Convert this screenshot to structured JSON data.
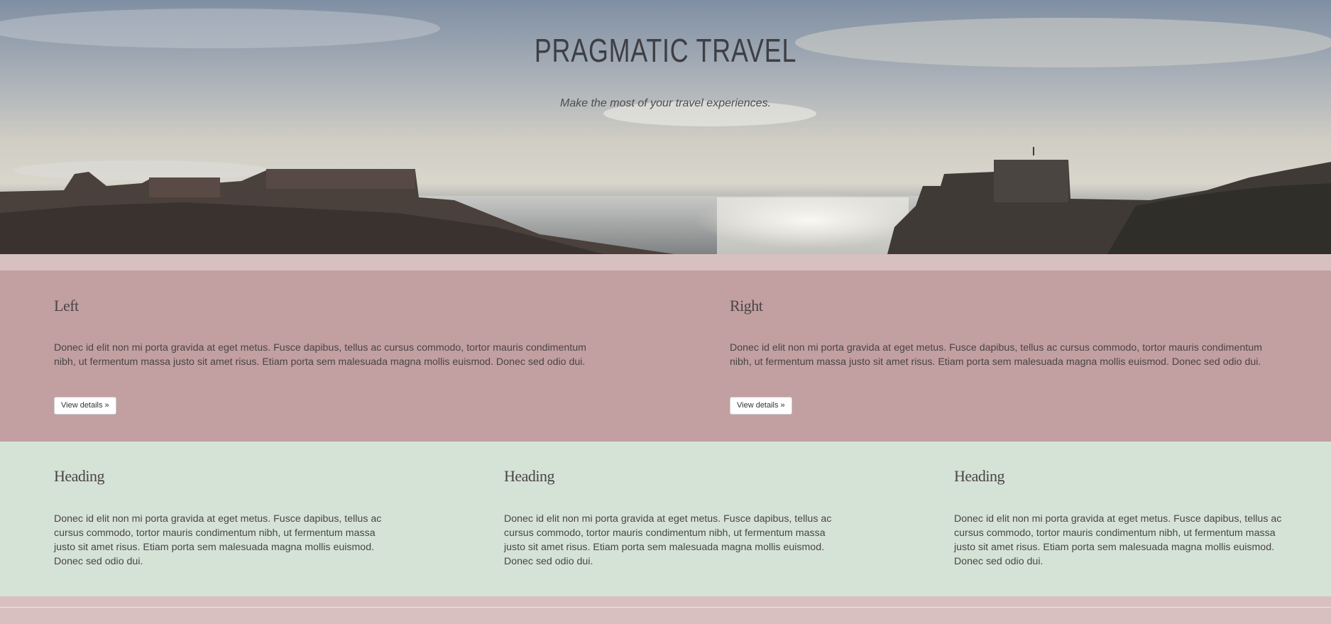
{
  "hero": {
    "title": "PRAGMATIC TRAVEL",
    "subtitle": "Make the most of your travel experiences."
  },
  "featured": [
    {
      "heading": "Left",
      "text": "Donec id elit non mi porta gravida at eget metus. Fusce dapibus, tellus ac cursus commodo, tortor mauris condimentum nibh, ut fermentum massa justo sit amet risus. Etiam porta sem malesuada magna mollis euismod. Donec sed odio dui.",
      "button": "View details »"
    },
    {
      "heading": "Right",
      "text": "Donec id elit non mi porta gravida at eget metus. Fusce dapibus, tellus ac cursus commodo, tortor mauris condimentum nibh, ut fermentum massa justo sit amet risus. Etiam porta sem malesuada magna mollis euismod. Donec sed odio dui.",
      "button": "View details »"
    }
  ],
  "columns": [
    {
      "heading": "Heading",
      "text": "Donec id elit non mi porta gravida at eget metus. Fusce dapibus, tellus ac cursus commodo, tortor mauris condimentum nibh, ut fermentum massa justo sit amet risus. Etiam porta sem malesuada magna mollis euismod. Donec sed odio dui."
    },
    {
      "heading": "Heading",
      "text": "Donec id elit non mi porta gravida at eget metus. Fusce dapibus, tellus ac cursus commodo, tortor mauris condimentum nibh, ut fermentum massa justo sit amet risus. Etiam porta sem malesuada magna mollis euismod. Donec sed odio dui."
    },
    {
      "heading": "Heading",
      "text": "Donec id elit non mi porta gravida at eget metus. Fusce dapibus, tellus ac cursus commodo, tortor mauris condimentum nibh, ut fermentum massa justo sit amet risus. Etiam porta sem malesuada magna mollis euismod. Donec sed odio dui."
    }
  ],
  "colors": {
    "page_bg": "#d9c0c0",
    "featured_bg": "#c29fa0",
    "columns_bg": "#d5e3d6",
    "text": "#4a4446"
  }
}
